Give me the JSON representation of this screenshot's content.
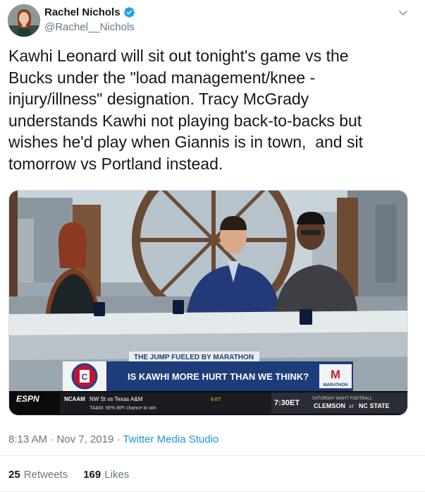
{
  "user": {
    "display_name": "Rachel Nichols",
    "handle": "@Rachel__Nichols",
    "verified": true
  },
  "tweet": {
    "text": "Kawhi Leonard will sit out tonight's game vs the\nBucks under the \"load management/knee -\ninjury/illness\" designation. Tracy McGrady\nunderstands Kawhi not playing back-to-backs but\nwishes he'd play when Giannis is in town,  and sit\ntomorrow vs Portland instead."
  },
  "media": {
    "show_bar": "THE JUMP FUELED BY MARATHON",
    "question": "IS KAWHI MORE HURT THAN WE THINK?",
    "sponsor": "MARATHON",
    "network": "ESPN",
    "ticker_league": "NCAAM",
    "ticker_game": "NW St vs Texas A&M",
    "ticker_stat": "TA&M: 95% BPI chance to win",
    "ticker_time": "8 ET",
    "promo_time": "7:30ET",
    "promo_title": "SATURDAY NIGHT FOOTBALL",
    "promo_matchup_a": "CLEMSON",
    "promo_at": "AT",
    "promo_matchup_b": "NC STATE"
  },
  "meta": {
    "time": "8:13 AM",
    "separator": " · ",
    "date": "Nov 7, 2019",
    "source": "Twitter Media Studio"
  },
  "stats": {
    "retweets_count": "25",
    "retweets_label": "Retweets",
    "likes_count": "169",
    "likes_label": "Likes"
  },
  "colors": {
    "verified": "#1da1f2",
    "link": "#1b95e0",
    "muted": "#657786",
    "espn_bar": "#1d3d7a",
    "marathon_red": "#cc1f2f"
  }
}
